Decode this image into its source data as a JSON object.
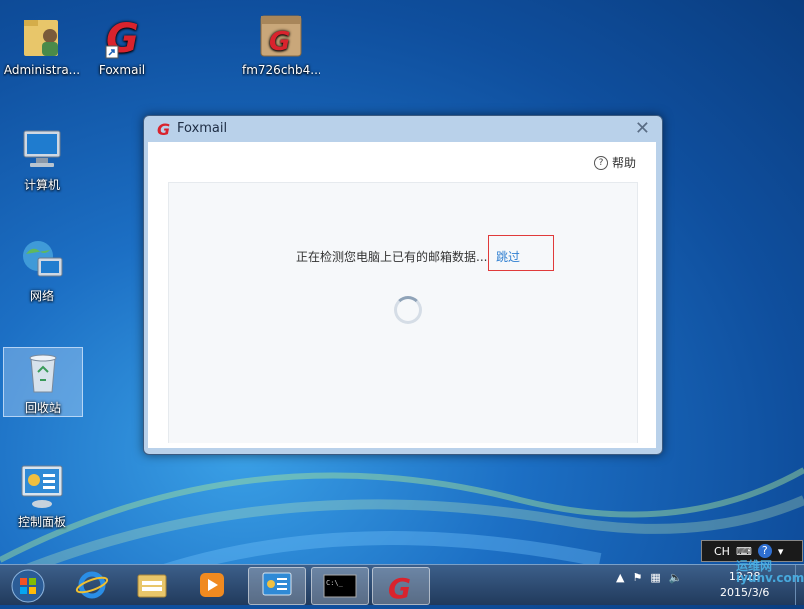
{
  "desktop": {
    "icons": [
      {
        "label": "Administra...",
        "icon": "user-folder-icon"
      },
      {
        "label": "Foxmail",
        "icon": "foxmail-shortcut-icon"
      },
      {
        "label": "fm726chb4...",
        "icon": "foxmail-installer-icon"
      },
      {
        "label": "计算机",
        "icon": "computer-icon"
      },
      {
        "label": "网络",
        "icon": "network-icon"
      },
      {
        "label": "回收站",
        "icon": "recycle-bin-icon"
      },
      {
        "label": "控制面板",
        "icon": "control-panel-icon"
      }
    ]
  },
  "window": {
    "title": "Foxmail",
    "help_label": "帮助",
    "help_icon": "?",
    "status_text": "正在检测您电脑上已有的邮箱数据...",
    "skip_label": "跳过"
  },
  "language_bar": {
    "lang": "CH"
  },
  "taskbar": {
    "clock_time": "12:28",
    "clock_date": "2015/3/6"
  },
  "watermark": {
    "line1": "运维网",
    "line2": "iyunv.com"
  },
  "colors": {
    "accent": "#2f7fd1",
    "highlight_border": "#e03a3a",
    "foxmail_red": "#d9232d"
  }
}
